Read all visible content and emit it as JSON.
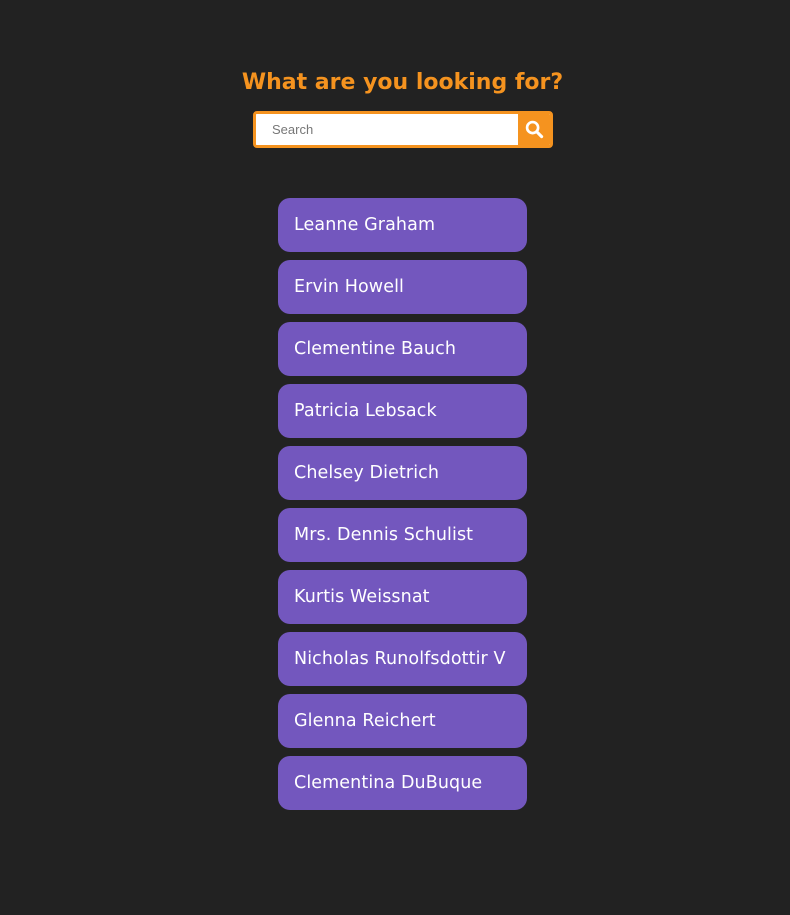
{
  "header": {
    "title": "What are you looking for?"
  },
  "search": {
    "placeholder": "Search",
    "value": "",
    "button_icon": "search-icon"
  },
  "colors": {
    "background": "#222222",
    "accent": "#f5931f",
    "item_background": "#7357be",
    "item_text": "#ffffff"
  },
  "results": [
    {
      "name": "Leanne Graham"
    },
    {
      "name": "Ervin Howell"
    },
    {
      "name": "Clementine Bauch"
    },
    {
      "name": "Patricia Lebsack"
    },
    {
      "name": "Chelsey Dietrich"
    },
    {
      "name": "Mrs. Dennis Schulist"
    },
    {
      "name": "Kurtis Weissnat"
    },
    {
      "name": "Nicholas Runolfsdottir V"
    },
    {
      "name": "Glenna Reichert"
    },
    {
      "name": "Clementina DuBuque"
    }
  ]
}
